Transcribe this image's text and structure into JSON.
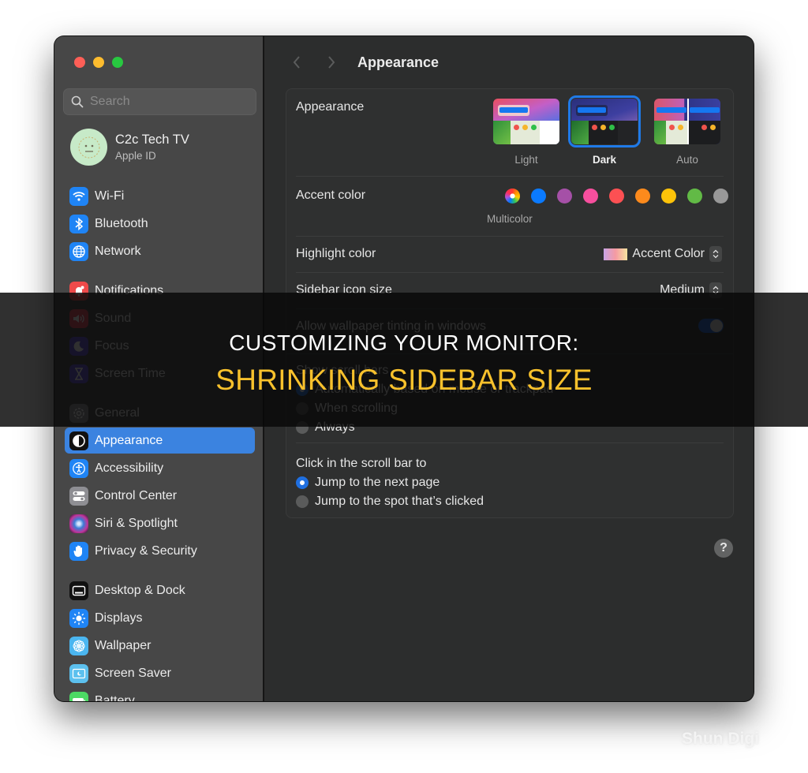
{
  "window": {
    "traffic_lights": [
      "close",
      "minimize",
      "zoom"
    ]
  },
  "sidebar": {
    "search": {
      "placeholder": "Search",
      "value": ""
    },
    "account": {
      "name": "C2c Tech TV",
      "subtitle": "Apple ID"
    },
    "items": [
      {
        "label": "Wi-Fi",
        "icon": "wifi-icon",
        "color": "#1f84f5"
      },
      {
        "label": "Bluetooth",
        "icon": "bluetooth-icon",
        "color": "#1f84f5"
      },
      {
        "label": "Network",
        "icon": "globe-icon",
        "color": "#1f84f5"
      },
      {
        "label": "Notifications",
        "icon": "bell-icon",
        "color": "#ef4a4a"
      },
      {
        "label": "Sound",
        "icon": "speaker-icon",
        "color": "#e8465a"
      },
      {
        "label": "Focus",
        "icon": "moon-icon",
        "color": "#5e4fd6"
      },
      {
        "label": "Screen Time",
        "icon": "hourglass-icon",
        "color": "#5e4fd6"
      },
      {
        "label": "General",
        "icon": "gear-icon",
        "color": "#8e8e93"
      },
      {
        "label": "Appearance",
        "icon": "appearance-icon",
        "color": "#111111",
        "active": true
      },
      {
        "label": "Accessibility",
        "icon": "accessibility-icon",
        "color": "#1f84f5"
      },
      {
        "label": "Control Center",
        "icon": "control-center-icon",
        "color": "#8e8e93"
      },
      {
        "label": "Siri & Spotlight",
        "icon": "siri-icon",
        "color": "#7a2f6e"
      },
      {
        "label": "Privacy & Security",
        "icon": "hand-icon",
        "color": "#1f84f5"
      },
      {
        "label": "Desktop & Dock",
        "icon": "dock-icon",
        "color": "#111111"
      },
      {
        "label": "Displays",
        "icon": "sun-icon",
        "color": "#1f84f5"
      },
      {
        "label": "Wallpaper",
        "icon": "flower-icon",
        "color": "#4bb6f0"
      },
      {
        "label": "Screen Saver",
        "icon": "screensaver-icon",
        "color": "#5cc0ee"
      },
      {
        "label": "Battery",
        "icon": "battery-icon",
        "color": "#4cd964"
      }
    ]
  },
  "main": {
    "title": "Appearance",
    "appearance": {
      "label": "Appearance",
      "options": [
        {
          "label": "Light",
          "selected": false
        },
        {
          "label": "Dark",
          "selected": true
        },
        {
          "label": "Auto",
          "selected": false
        }
      ]
    },
    "accent": {
      "label": "Accent color",
      "selected_label": "Multicolor",
      "colors": [
        {
          "name": "multicolor",
          "hex": "multicolor"
        },
        {
          "name": "blue",
          "hex": "#0a7aff"
        },
        {
          "name": "purple",
          "hex": "#a550a7"
        },
        {
          "name": "pink",
          "hex": "#f74f9e"
        },
        {
          "name": "red",
          "hex": "#fc5053"
        },
        {
          "name": "orange",
          "hex": "#fd8a1c"
        },
        {
          "name": "yellow",
          "hex": "#fdc309"
        },
        {
          "name": "green",
          "hex": "#62ba46"
        },
        {
          "name": "graphite",
          "hex": "#989898"
        }
      ]
    },
    "highlight": {
      "label": "Highlight color",
      "value": "Accent Color"
    },
    "sidebar_icon_size": {
      "label": "Sidebar icon size",
      "value": "Medium"
    },
    "wallpaper_tinting": {
      "label": "Allow wallpaper tinting in windows",
      "enabled": true
    },
    "scroll_bars": {
      "label": "Show scroll bars",
      "options": [
        {
          "label": "Automatically based on mouse or trackpad",
          "selected": true
        },
        {
          "label": "When scrolling",
          "selected": false
        },
        {
          "label": "Always",
          "selected": false
        }
      ]
    },
    "click_scroll": {
      "label": "Click in the scroll bar to",
      "options": [
        {
          "label": "Jump to the next page",
          "selected": true
        },
        {
          "label": "Jump to the spot that’s clicked",
          "selected": false
        }
      ]
    },
    "help_label": "?"
  },
  "banner": {
    "line1": "CUSTOMIZING YOUR MONITOR:",
    "line2": "SHRINKING SIDEBAR SIZE",
    "line1_color": "#ffffff",
    "line2_color": "#f8c12c"
  },
  "watermark": "Shun Digi"
}
